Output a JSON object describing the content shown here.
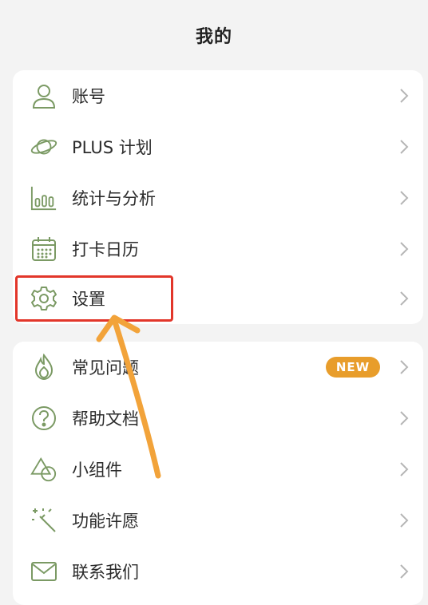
{
  "header": {
    "title": "我的"
  },
  "menu1": [
    {
      "label": "账号",
      "icon": "person-icon"
    },
    {
      "label": "PLUS 计划",
      "icon": "planet-icon"
    },
    {
      "label": "统计与分析",
      "icon": "bar-chart-icon"
    },
    {
      "label": "打卡日历",
      "icon": "calendar-icon"
    },
    {
      "label": "设置",
      "icon": "gear-icon"
    }
  ],
  "menu2": [
    {
      "label": "常见问题",
      "icon": "flame-icon",
      "badge": "NEW"
    },
    {
      "label": "帮助文档",
      "icon": "question-icon"
    },
    {
      "label": "小组件",
      "icon": "shapes-icon"
    },
    {
      "label": "功能许愿",
      "icon": "magic-wand-icon"
    },
    {
      "label": "联系我们",
      "icon": "mail-icon"
    }
  ],
  "colors": {
    "icon_green": "#7b9a64",
    "highlight_red": "#e2362a",
    "arrow_orange": "#f2a33a",
    "badge_orange": "#e89d2b"
  }
}
